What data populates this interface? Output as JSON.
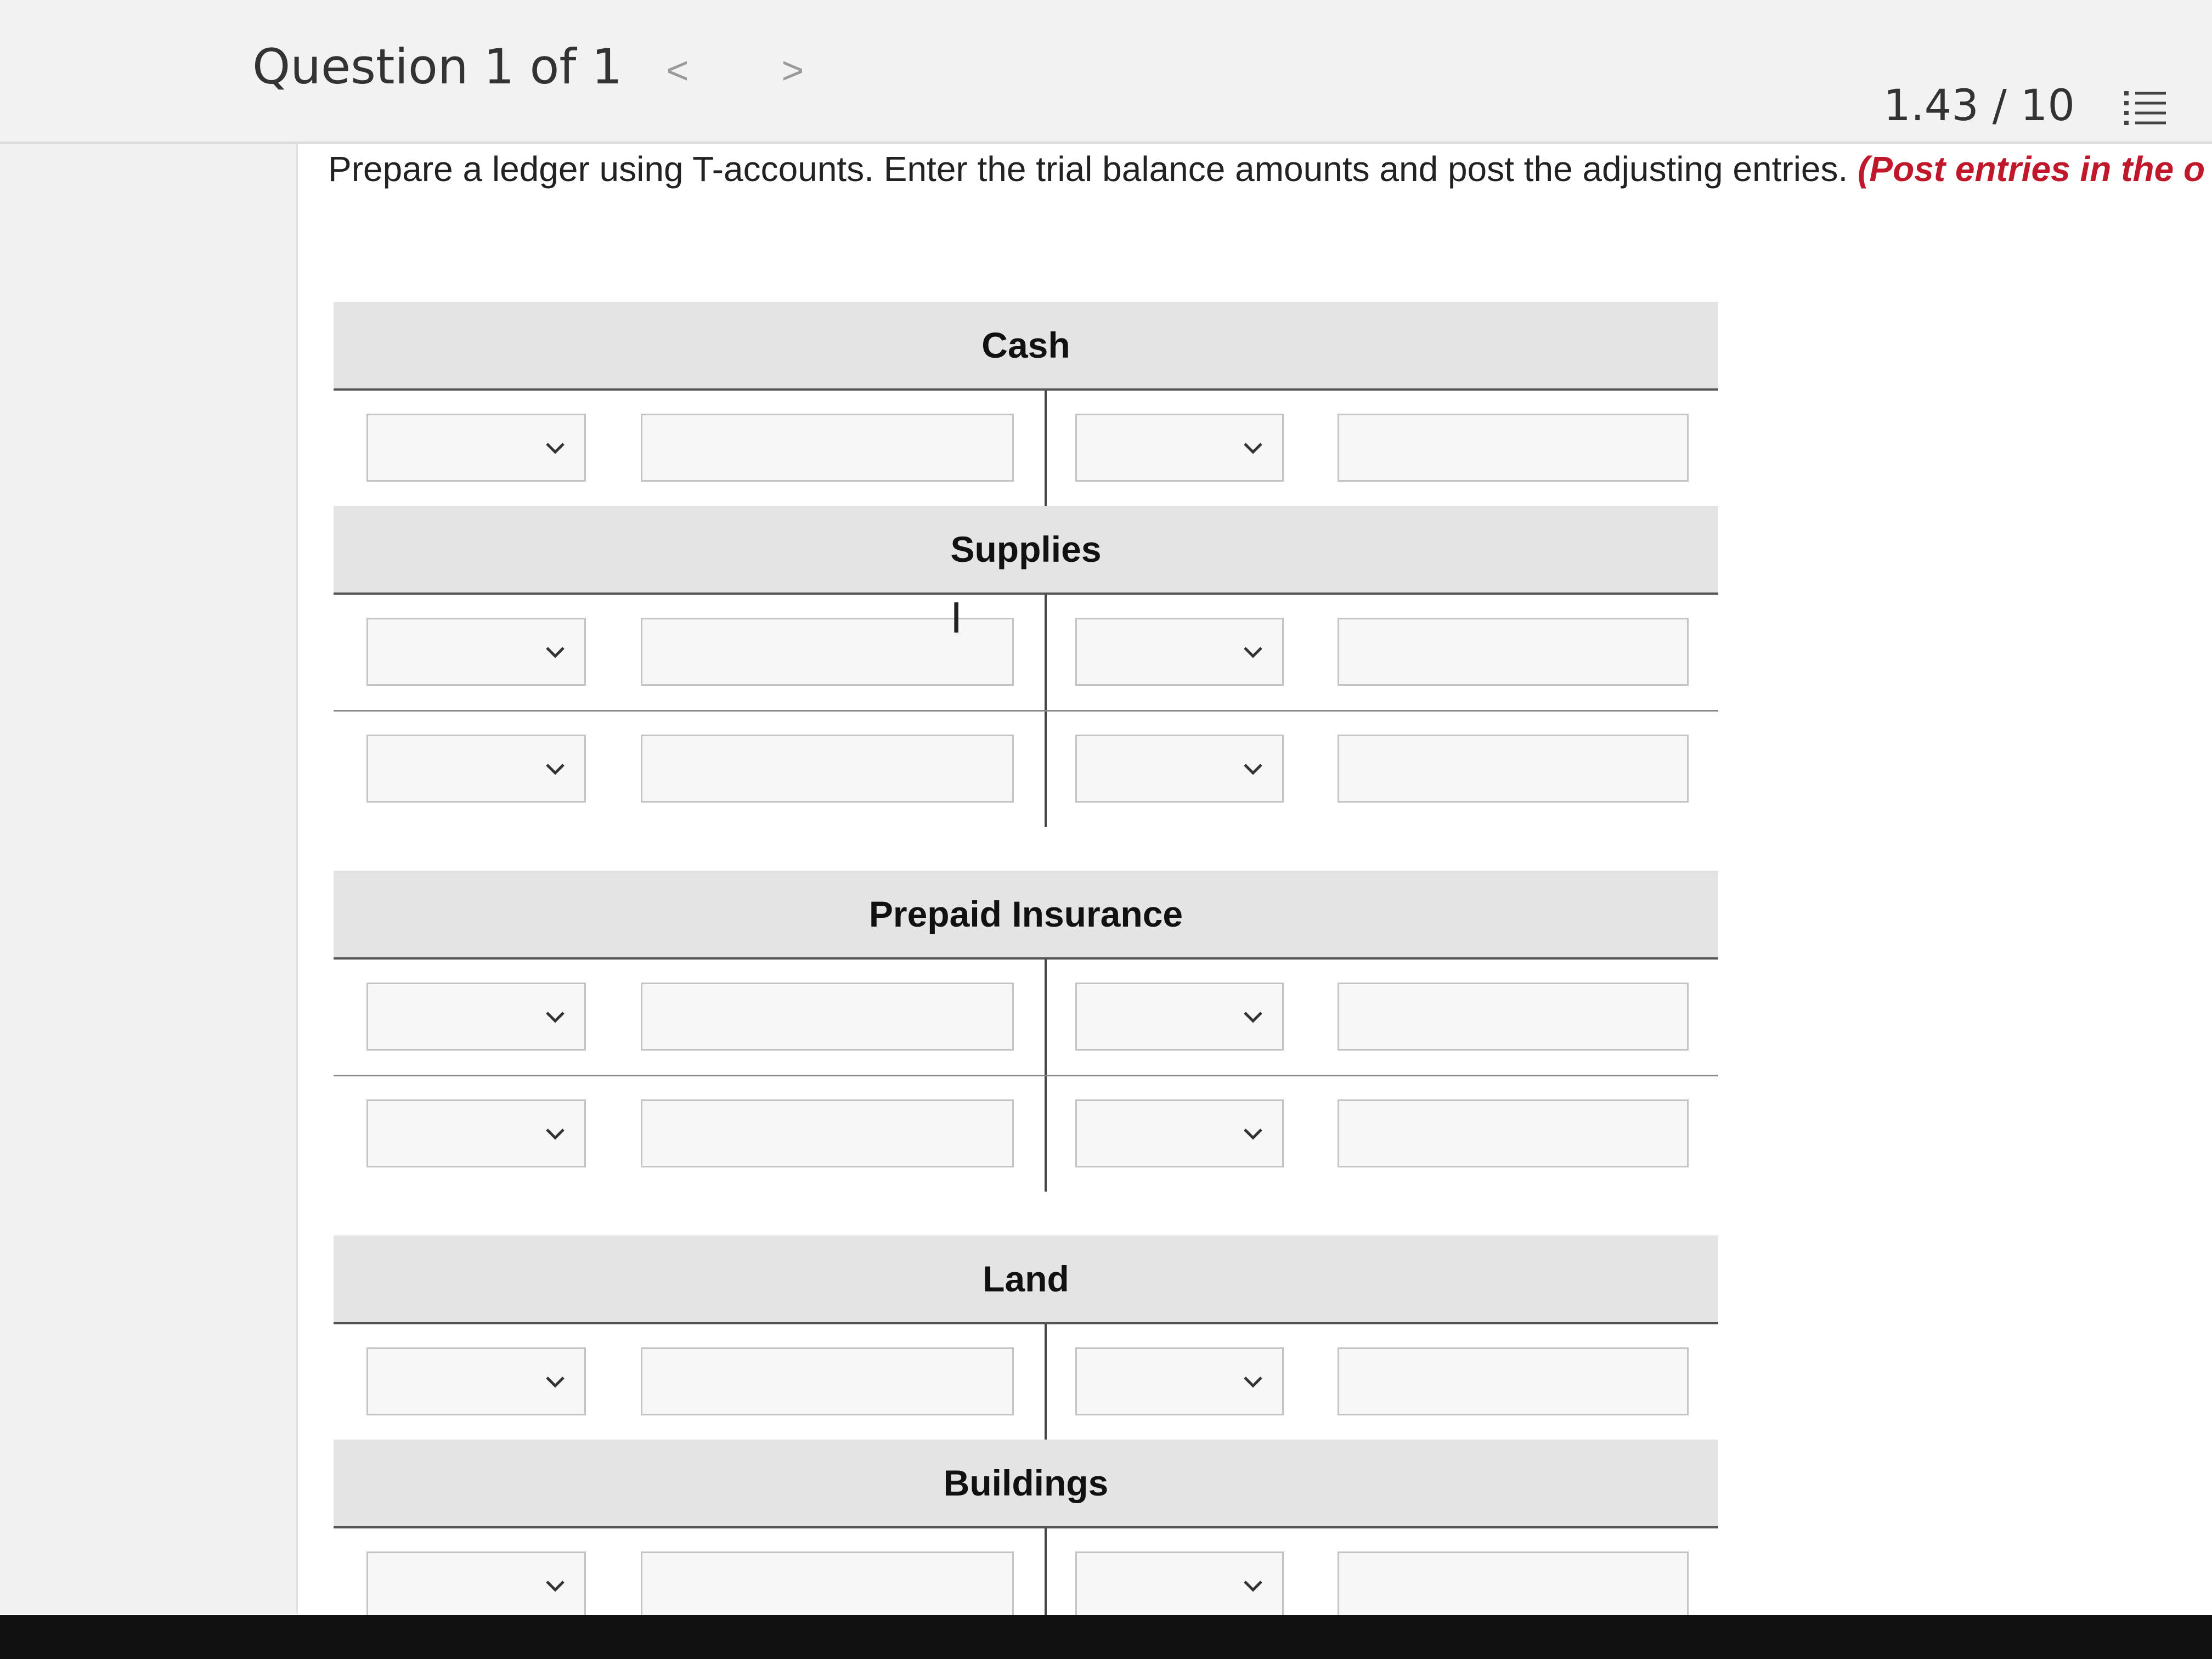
{
  "header": {
    "question_label": "Question 1 of 1",
    "prev_symbol": "<",
    "next_symbol": ">",
    "score": "1.43 / 10"
  },
  "instructions": {
    "main": "Prepare a ledger using T-accounts. Enter the trial balance amounts and post the adjusting entries. ",
    "note": "(Post entries in the order of journal entries presented in the previous question.)"
  },
  "accounts": [
    {
      "name": "Cash",
      "rows": 1
    },
    {
      "name": "Supplies",
      "rows": 2
    },
    {
      "name": "Prepaid Insurance",
      "rows": 2
    },
    {
      "name": "Land",
      "rows": 1
    },
    {
      "name": "Buildings",
      "rows": 1
    }
  ],
  "icons": {
    "list": "numbered-list-icon",
    "dropdown": "chevron-down-icon",
    "text_cursor": "i-beam-cursor-icon"
  }
}
